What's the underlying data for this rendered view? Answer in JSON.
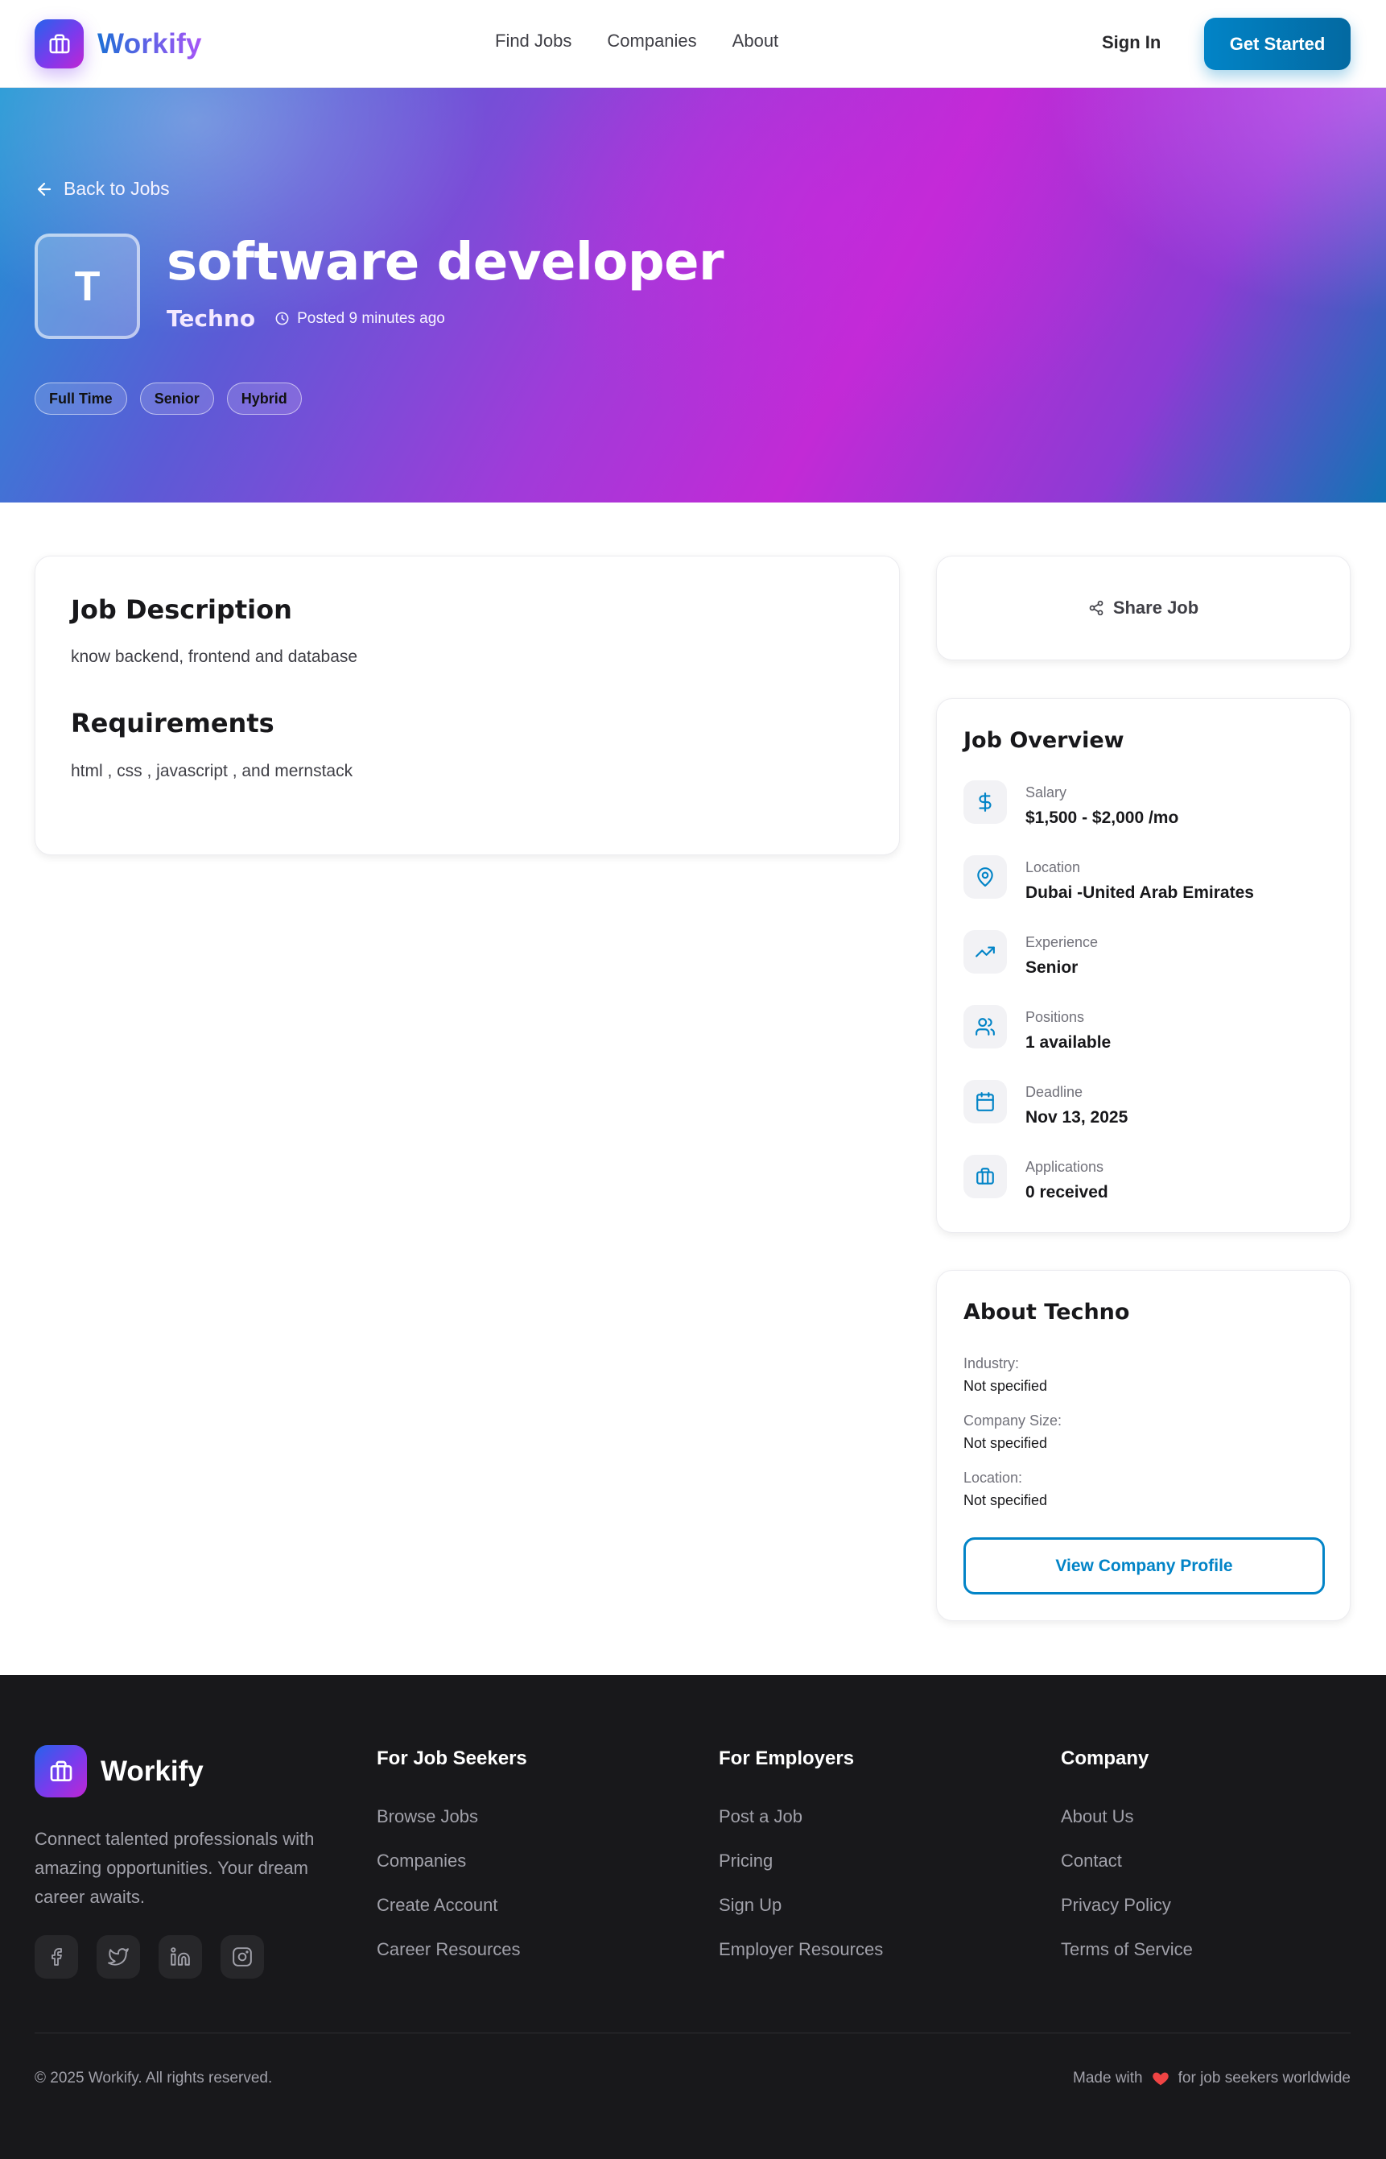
{
  "nav": {
    "brand": "Workify",
    "links": [
      "Find Jobs",
      "Companies",
      "About"
    ],
    "sign_in": "Sign In",
    "get_started": "Get Started"
  },
  "hero": {
    "back_label": "Back to Jobs",
    "avatar_letter": "T",
    "title": "software developer",
    "company": "Techno",
    "posted": "Posted 9 minutes ago",
    "tags": [
      "Full Time",
      "Senior",
      "Hybrid"
    ]
  },
  "description": {
    "heading": "Job Description",
    "text": "know backend, frontend and database",
    "requirements_heading": "Requirements",
    "requirements_text": "html , css , javascript , and mernstack"
  },
  "share": {
    "label": "Share Job"
  },
  "overview": {
    "heading": "Job Overview",
    "items": [
      {
        "label": "Salary",
        "value": "$1,500 - $2,000 /mo",
        "icon": "dollar-icon"
      },
      {
        "label": "Location",
        "value": "Dubai -United Arab Emirates",
        "icon": "map-pin-icon"
      },
      {
        "label": "Experience",
        "value": "Senior",
        "icon": "trending-up-icon"
      },
      {
        "label": "Positions",
        "value": "1 available",
        "icon": "users-icon"
      },
      {
        "label": "Deadline",
        "value": "Nov 13, 2025",
        "icon": "calendar-icon"
      },
      {
        "label": "Applications",
        "value": "0 received",
        "icon": "briefcase-icon"
      }
    ]
  },
  "about": {
    "heading": "About Techno",
    "rows": [
      {
        "key": "Industry:",
        "value": "Not specified"
      },
      {
        "key": "Company Size:",
        "value": "Not specified"
      },
      {
        "key": "Location:",
        "value": "Not specified"
      }
    ],
    "button": "View Company Profile"
  },
  "footer": {
    "brand": "Workify",
    "tagline": "Connect talented professionals with amazing opportunities. Your dream career awaits.",
    "columns": [
      {
        "heading": "For Job Seekers",
        "links": [
          "Browse Jobs",
          "Companies",
          "Create Account",
          "Career Resources"
        ]
      },
      {
        "heading": "For Employers",
        "links": [
          "Post a Job",
          "Pricing",
          "Sign Up",
          "Employer Resources"
        ]
      },
      {
        "heading": "Company",
        "links": [
          "About Us",
          "Contact",
          "Privacy Policy",
          "Terms of Service"
        ]
      }
    ],
    "copyright": "© 2025 Workify. All rights reserved.",
    "made_with_prefix": "Made with",
    "made_with_suffix": "for job seekers worldwide"
  },
  "colors": {
    "accent": "#0284c7",
    "brand_gradient_start": "#2563eb",
    "brand_gradient_end": "#c026d3",
    "footer_bg": "#18181b",
    "heart": "#ef4444"
  }
}
